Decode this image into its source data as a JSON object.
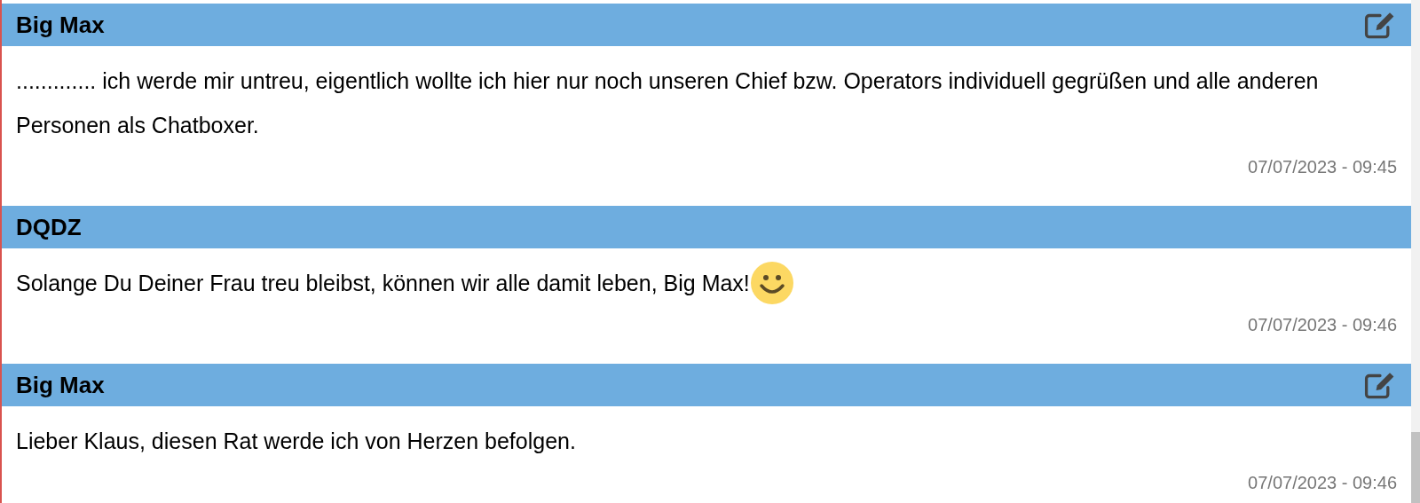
{
  "messages": [
    {
      "author": "Big Max",
      "editable": true,
      "text": "............. ich werde mir untreu, eigentlich wollte ich hier nur noch unseren Chief bzw. Operators individuell gegrüßen und alle anderen Personen als Chatboxer.",
      "smiley": false,
      "timestamp": "07/07/2023 - 09:45"
    },
    {
      "author": "DQDZ",
      "editable": false,
      "text": "Solange Du Deiner Frau treu bleibst, können wir alle damit leben, Big Max!",
      "smiley": true,
      "timestamp": "07/07/2023 - 09:46"
    },
    {
      "author": "Big Max",
      "editable": true,
      "text": "Lieber Klaus, diesen Rat werde ich von Herzen befolgen.",
      "smiley": false,
      "timestamp": "07/07/2023 - 09:46"
    }
  ]
}
